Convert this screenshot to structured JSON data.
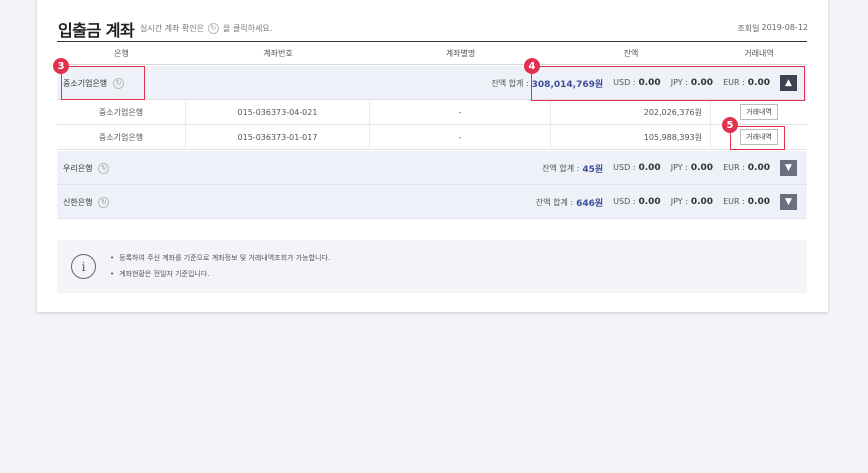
{
  "page": {
    "title": "입출금 계좌",
    "hint_before": "실시간 계좌 확인은",
    "hint_after": "을 클릭하세요.",
    "date_label": "조회일",
    "date_value": "2019-08-12"
  },
  "table": {
    "headers": [
      "은행",
      "계좌번호",
      "계좌별명",
      "잔액",
      "거래내역"
    ]
  },
  "banks": [
    {
      "name": "중소기업은행",
      "balance_label": "잔액 합계 :",
      "balance": "308,014,769원",
      "usd_label": "USD :",
      "usd": "0.00",
      "jpy_label": "JPY :",
      "jpy": "0.00",
      "eur_label": "EUR :",
      "eur": "0.00",
      "toggle": "up",
      "accounts": [
        {
          "bank": "중소기업은행",
          "number": "015-036373-04-021",
          "alias": "-",
          "balance": "202,026,376원",
          "history_label": "거래내역"
        },
        {
          "bank": "중소기업은행",
          "number": "015-036373-01-017",
          "alias": "-",
          "balance": "105,988,393원",
          "history_label": "거래내역"
        }
      ]
    },
    {
      "name": "우리은행",
      "balance_label": "잔액 합계 :",
      "balance": "45원",
      "usd_label": "USD :",
      "usd": "0.00",
      "jpy_label": "JPY :",
      "jpy": "0.00",
      "eur_label": "EUR :",
      "eur": "0.00",
      "toggle": "down"
    },
    {
      "name": "신한은행",
      "balance_label": "잔액 합계 :",
      "balance": "646원",
      "usd_label": "USD :",
      "usd": "0.00",
      "jpy_label": "JPY :",
      "jpy": "0.00",
      "eur_label": "EUR :",
      "eur": "0.00",
      "toggle": "down"
    }
  ],
  "annotations": {
    "badge3": "3",
    "badge4": "4",
    "badge5": "5",
    "color": "#e0324f"
  },
  "notice": {
    "icon": "info-icon",
    "lines": [
      "등록하여 주신 계좌를 기준으로 계좌정보 및 거래내역조회가 가능합니다.",
      "계좌현황은 전일자 기준입니다."
    ]
  }
}
